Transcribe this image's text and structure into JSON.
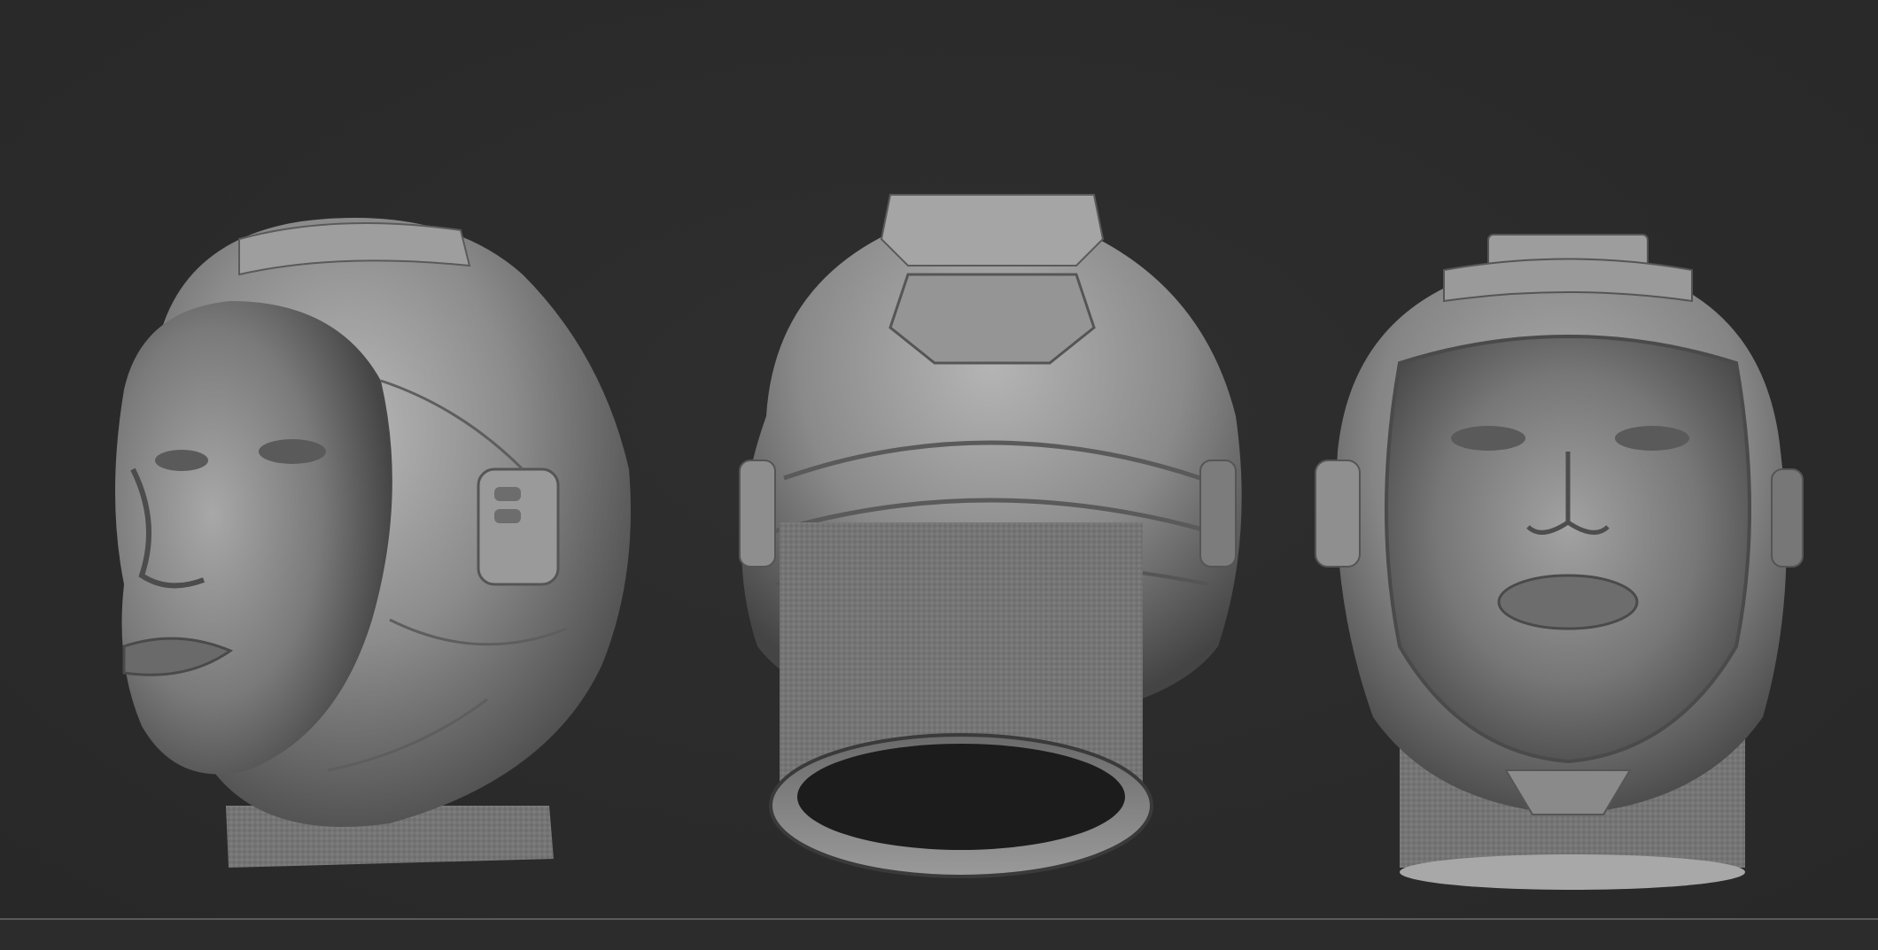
{
  "viewport": {
    "background_color": "#2b2b2b",
    "material_color": "#8a8a8a",
    "views": [
      {
        "name": "three-quarter-left",
        "description_icon": "sculpt-head-3q-left"
      },
      {
        "name": "back",
        "description_icon": "sculpt-head-back"
      },
      {
        "name": "front",
        "description_icon": "sculpt-head-front"
      }
    ]
  },
  "status_bar": {
    "divider_color": "#5a5a5a"
  }
}
